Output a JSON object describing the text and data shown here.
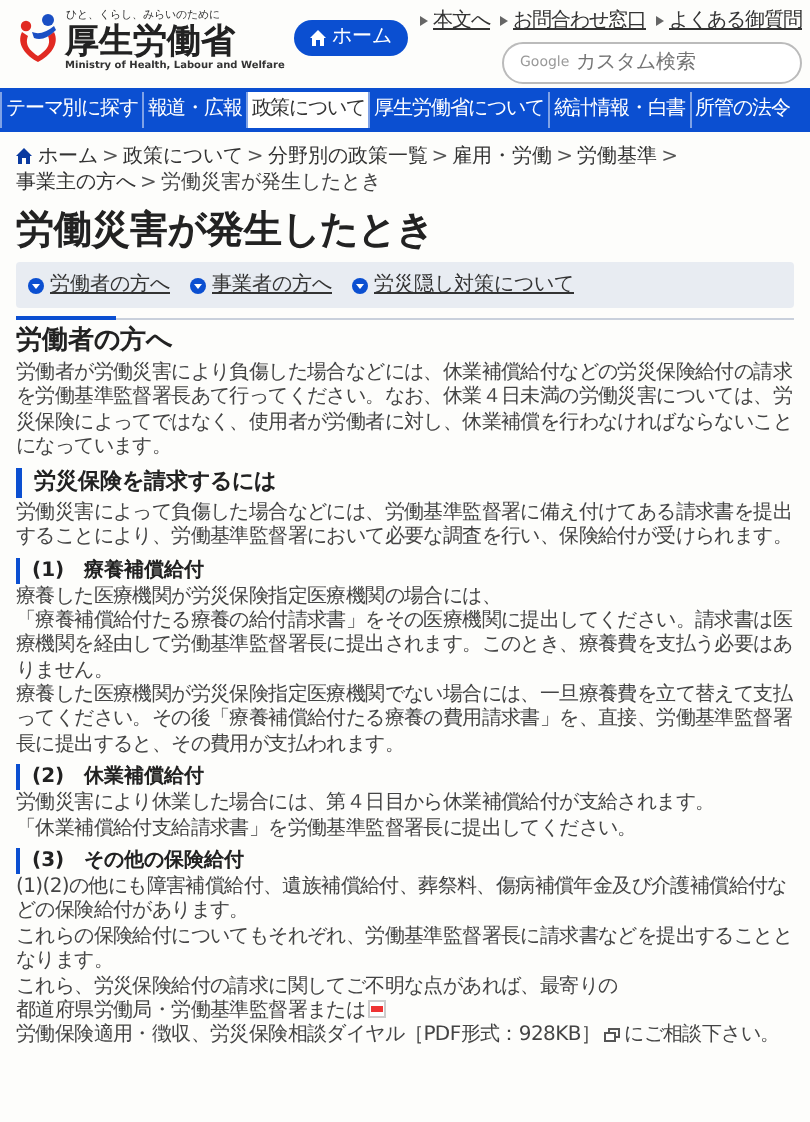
{
  "header": {
    "tagline": "ひと、くらし、みらいのために",
    "logo_text": "厚生労働省",
    "logo_english": "Ministry of Health, Labour and Welfare",
    "home_button": "ホーム",
    "utility_links": [
      "本文へ",
      "お問合わせ窓口",
      "よくある御質問"
    ],
    "search": {
      "brand": "Google",
      "placeholder": "カスタム検索"
    }
  },
  "nav": [
    {
      "label": "テーマ別に探す",
      "selected": false
    },
    {
      "label": "報道・広報",
      "selected": false
    },
    {
      "label": "政策について",
      "selected": true
    },
    {
      "label": "厚生労働省について",
      "selected": false
    },
    {
      "label": "統計情報・白書",
      "selected": false
    },
    {
      "label": "所管の法令",
      "selected": false
    }
  ],
  "breadcrumb": {
    "separator": ">",
    "items": [
      "ホーム",
      "政策について",
      "分野別の政策一覧",
      "雇用・労働",
      "労働基準",
      "事業主の方へ",
      "労働災害が発生したとき"
    ]
  },
  "title": "労働災害が発生したとき",
  "anchors": [
    "労働者の方へ",
    "事業者の方へ",
    "労災隠し対策について"
  ],
  "sections": [
    {
      "kind": "h2",
      "text": "労働者の方へ"
    },
    {
      "kind": "p",
      "runs": [
        {
          "kind": "text",
          "text": "労働者が労働災害により負傷した場合などには、休業補償給付などの労災保険給付の請求を労働基準監督署長あて行ってください。なお、休業４日未満の労働災害については、労災保険によってではなく、使用者が労働者に対し、休業補償を行わなければならないことになっています。"
        }
      ]
    },
    {
      "kind": "h3",
      "text": "労災保険を請求するには"
    },
    {
      "kind": "p",
      "runs": [
        {
          "kind": "text",
          "text": "労働災害によって負傷した場合などには、労働基準監督署に備え付けてある請求書を提出することにより、労働基準監督署において必要な調査を行い、保険給付が受けられます。"
        }
      ]
    },
    {
      "kind": "h4",
      "number": "(1)",
      "text": "療養補償給付"
    },
    {
      "kind": "p",
      "runs": [
        {
          "kind": "text",
          "text": "療養した医療機関が労災保険指定医療機関の場合には、"
        },
        {
          "kind": "link",
          "text": "「療養補償給付たる療養の給付請求書」"
        },
        {
          "kind": "text",
          "text": "をその医療機関に提出してください。請求書は医療機関を経由して労働基準監督署長に提出されます。このとき、療養費を支払う必要はありません。"
        },
        {
          "kind": "break"
        },
        {
          "kind": "text",
          "text": "療養した医療機関が労災保険指定医療機関でない場合には、一旦療養費を立て替えて支払ってください。その後"
        },
        {
          "kind": "link",
          "text": "「療養補償給付たる療養の費用請求書」"
        },
        {
          "kind": "text",
          "text": "を、直接、労働基準監督署長に提出すると、その費用が支払われます。"
        }
      ]
    },
    {
      "kind": "h4",
      "number": "(2)",
      "text": "休業補償給付"
    },
    {
      "kind": "p",
      "runs": [
        {
          "kind": "text",
          "text": "労働災害により休業した場合には、第４日目から休業補償給付が支給されます。"
        },
        {
          "kind": "link",
          "text": "「休業補償給付支給請求書」"
        },
        {
          "kind": "text",
          "text": "を労働基準監督署長に提出してください。"
        }
      ]
    },
    {
      "kind": "h4",
      "number": "(3)",
      "text": "その他の保険給付"
    },
    {
      "kind": "p",
      "runs": [
        {
          "kind": "text",
          "text": "(1)(2)の他にも障害補償給付、遺族補償給付、葬祭料、傷病補償年金及び介護補償給付などの保険給付があります。"
        },
        {
          "kind": "break"
        },
        {
          "kind": "text",
          "text": "これらの保険給付についてもそれぞれ、労働基準監督署長に請求書などを提出することとなります。"
        },
        {
          "kind": "break"
        },
        {
          "kind": "text",
          "text": "これら、労災保険給付の請求に関してご不明な点があれば、最寄りの"
        },
        {
          "kind": "link",
          "text": "都道府県労働局・労働基準監督署"
        },
        {
          "kind": "text",
          "text": "または"
        },
        {
          "kind": "pdf_link",
          "text": "労働保険適用・徴収、労災保険相談ダイヤル［PDF形式：928KB］"
        },
        {
          "kind": "text",
          "text": "にご相談下さい。"
        }
      ]
    }
  ]
}
